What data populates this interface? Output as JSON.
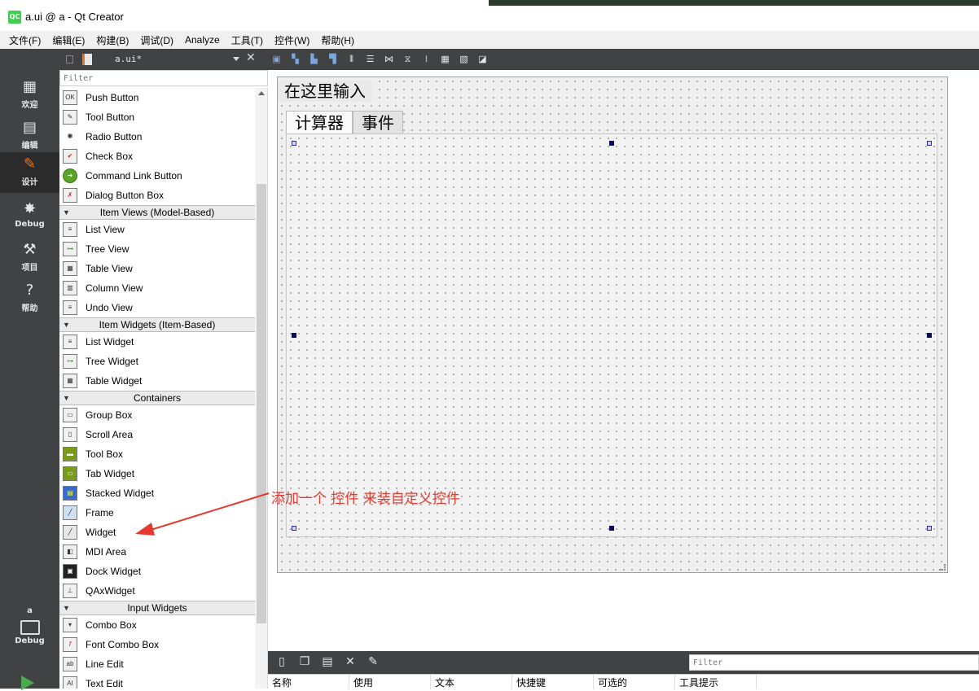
{
  "window": {
    "app_icon": "QC",
    "title": "a.ui @ a - Qt Creator"
  },
  "menu": [
    "文件(F)",
    "编辑(E)",
    "构建(B)",
    "调试(D)",
    "Analyze",
    "工具(T)",
    "控件(W)",
    "帮助(H)"
  ],
  "modes": [
    {
      "label": "欢迎",
      "icon": "grid-icon"
    },
    {
      "label": "编辑",
      "icon": "document-icon"
    },
    {
      "label": "设计",
      "icon": "pencil-icon",
      "active": true
    },
    {
      "label": "Debug",
      "icon": "bug-icon"
    },
    {
      "label": "项目",
      "icon": "wrench-icon"
    },
    {
      "label": "帮助",
      "icon": "help-icon"
    }
  ],
  "kit": {
    "project": "a",
    "label": "Debug"
  },
  "editor": {
    "file": "a.ui*"
  },
  "widget_box": {
    "filter_placeholder": "Filter",
    "buttons": [
      "Push Button",
      "Tool Button",
      "Radio Button",
      "Check Box",
      "Command Link Button",
      "Dialog Button Box"
    ],
    "item_views_header": "Item Views (Model-Based)",
    "item_views": [
      "List View",
      "Tree View",
      "Table View",
      "Column View",
      "Undo View"
    ],
    "item_widgets_header": "Item Widgets (Item-Based)",
    "item_widgets": [
      "List Widget",
      "Tree Widget",
      "Table Widget"
    ],
    "containers_header": "Containers",
    "containers": [
      "Group Box",
      "Scroll Area",
      "Tool Box",
      "Tab Widget",
      "Stacked Widget",
      "Frame",
      "Widget",
      "MDI Area",
      "Dock Widget",
      "QAxWidget"
    ],
    "input_widgets_header": "Input Widgets",
    "input_widgets": [
      "Combo Box",
      "Font Combo Box",
      "Line Edit",
      "Text Edit"
    ]
  },
  "form": {
    "label": "在这里输入",
    "tabs": [
      "计算器",
      "事件"
    ]
  },
  "annotation": "添加一个 控件 来装自定义控件",
  "action_editor": {
    "filter_placeholder": "Filter",
    "columns": [
      "名称",
      "使用",
      "文本",
      "快捷键",
      "可选的",
      "工具提示"
    ]
  },
  "colors": {
    "mode_bar": "#404244",
    "active_mode_icon": "#e07a2a",
    "annotation": "#e5392f",
    "qt_green": "#41cd52"
  }
}
